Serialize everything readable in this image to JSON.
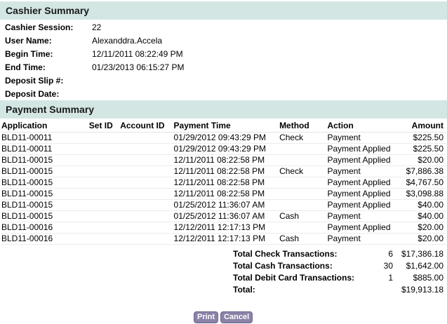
{
  "cashier": {
    "title": "Cashier Summary",
    "session_label": "Cashier Session:",
    "session_value": "22",
    "user_label": "User Name:",
    "user_value": "Alexanddra.Accela",
    "begin_label": "Begin Time:",
    "begin_value": "12/11/2011 08:22:49 PM",
    "end_label": "End Time:",
    "end_value": "01/23/2013 06:15:27 PM",
    "slip_label": "Deposit Slip #:",
    "slip_value": "",
    "date_label": "Deposit Date:",
    "date_value": ""
  },
  "payment": {
    "title": "Payment Summary",
    "columns": [
      "Application",
      "Set ID",
      "Account ID",
      "Payment Time",
      "Method",
      "Action",
      "Amount"
    ],
    "rows": [
      [
        "BLD11-00011",
        "",
        "",
        "01/29/2012 09:43:29 PM",
        "Check",
        "Payment",
        "$225.50"
      ],
      [
        "BLD11-00011",
        "",
        "",
        "01/29/2012 09:43:29 PM",
        "",
        "Payment Applied",
        "$225.50"
      ],
      [
        "BLD11-00015",
        "",
        "",
        "12/11/2011 08:22:58 PM",
        "",
        "Payment Applied",
        "$20.00"
      ],
      [
        "BLD11-00015",
        "",
        "",
        "12/11/2011 08:22:58 PM",
        "Check",
        "Payment",
        "$7,886.38"
      ],
      [
        "BLD11-00015",
        "",
        "",
        "12/11/2011 08:22:58 PM",
        "",
        "Payment Applied",
        "$4,767.50"
      ],
      [
        "BLD11-00015",
        "",
        "",
        "12/11/2011 08:22:58 PM",
        "",
        "Payment Applied",
        "$3,098.88"
      ],
      [
        "BLD11-00015",
        "",
        "",
        "01/25/2012 11:36:07 AM",
        "",
        "Payment Applied",
        "$40.00"
      ],
      [
        "BLD11-00015",
        "",
        "",
        "01/25/2012 11:36:07 AM",
        "Cash",
        "Payment",
        "$40.00"
      ],
      [
        "BLD11-00016",
        "",
        "",
        "12/12/2011 12:17:13 PM",
        "",
        "Payment Applied",
        "$20.00"
      ],
      [
        "BLD11-00016",
        "",
        "",
        "12/12/2011 12:17:13 PM",
        "Cash",
        "Payment",
        "$20.00"
      ]
    ]
  },
  "totals": {
    "check_label": "Total Check Transactions:",
    "check_count": "6",
    "check_amount": "$17,386.18",
    "cash_label": "Total Cash Transactions:",
    "cash_count": "30",
    "cash_amount": "$1,642.00",
    "debit_label": "Total Debit Card Transactions:",
    "debit_count": "1",
    "debit_amount": "$885.00",
    "total_label": "Total:",
    "total_amount": "$19,913.18"
  },
  "buttons": {
    "print_label": "Print",
    "cancel_label": "Cancel"
  }
}
